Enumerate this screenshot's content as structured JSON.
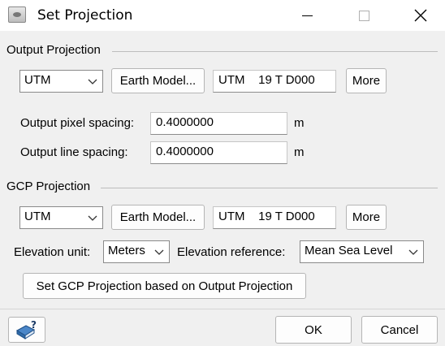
{
  "window": {
    "title": "Set Projection"
  },
  "output_projection": {
    "label": "Output Projection",
    "projection_type": "UTM",
    "earth_model_label": "Earth Model...",
    "zone_value": "UTM    19 T D000",
    "more_label": "More",
    "pixel_spacing_label": "Output pixel spacing:",
    "pixel_spacing_value": "0.4000000",
    "pixel_spacing_unit": "m",
    "line_spacing_label": "Output line spacing:",
    "line_spacing_value": "0.4000000",
    "line_spacing_unit": "m"
  },
  "gcp_projection": {
    "label": "GCP Projection",
    "projection_type": "UTM",
    "earth_model_label": "Earth Model...",
    "zone_value": "UTM    19 T D000",
    "more_label": "More",
    "elevation_unit_label": "Elevation unit:",
    "elevation_unit_value": "Meters",
    "elevation_reference_label": "Elevation reference:",
    "elevation_reference_value": "Mean Sea Level",
    "set_from_output_label": "Set GCP Projection based on Output Projection"
  },
  "footer": {
    "ok_label": "OK",
    "cancel_label": "Cancel",
    "help_icon": "help-book-icon"
  }
}
